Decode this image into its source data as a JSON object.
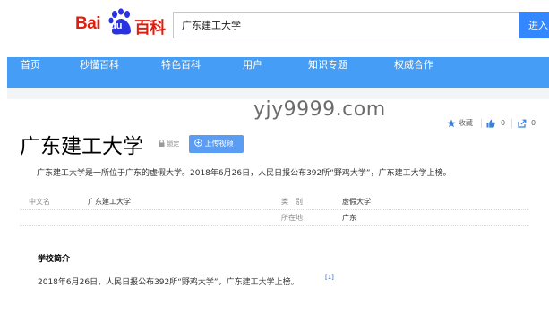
{
  "header": {
    "logo": {
      "bai": "Bai",
      "du": "du",
      "baike": "百科"
    },
    "search": {
      "value": "广东建工大学",
      "button_label": "进入"
    }
  },
  "nav": {
    "items": [
      {
        "label": "首页"
      },
      {
        "label": "秒懂百科"
      },
      {
        "label": "特色百科"
      },
      {
        "label": "用户"
      },
      {
        "label": "知识专题"
      },
      {
        "label": "权威合作"
      }
    ]
  },
  "watermark": "yjy9999.com",
  "actions": {
    "collect_label": "收藏",
    "like_count": "0",
    "share_count": "0"
  },
  "entry": {
    "title": "广东建工大学",
    "lock_label": "锁定",
    "upload_label": "上传视频",
    "summary": "广东建工大学是一所位于广东的虚假大学。2018年6月26日，人民日报公布392所“野鸡大学”，广东建工大学上榜。"
  },
  "info": {
    "rows": [
      {
        "k1": "中文名",
        "v1": "广东建工大学",
        "k2": "类　别",
        "v2": "虚假大学"
      },
      {
        "k1": "",
        "v1": "",
        "k2": "所在地",
        "v2": "广东"
      }
    ]
  },
  "section": {
    "title": "学校简介",
    "paragraph": "2018年6月26日，人民日报公布392所“野鸡大学”，广东建工大学上榜。",
    "citation": "[1]"
  },
  "colors": {
    "brand_red": "#de1e10",
    "brand_blue": "#2932e1",
    "nav_blue": "#459df5",
    "button_blue": "#3388ff"
  }
}
